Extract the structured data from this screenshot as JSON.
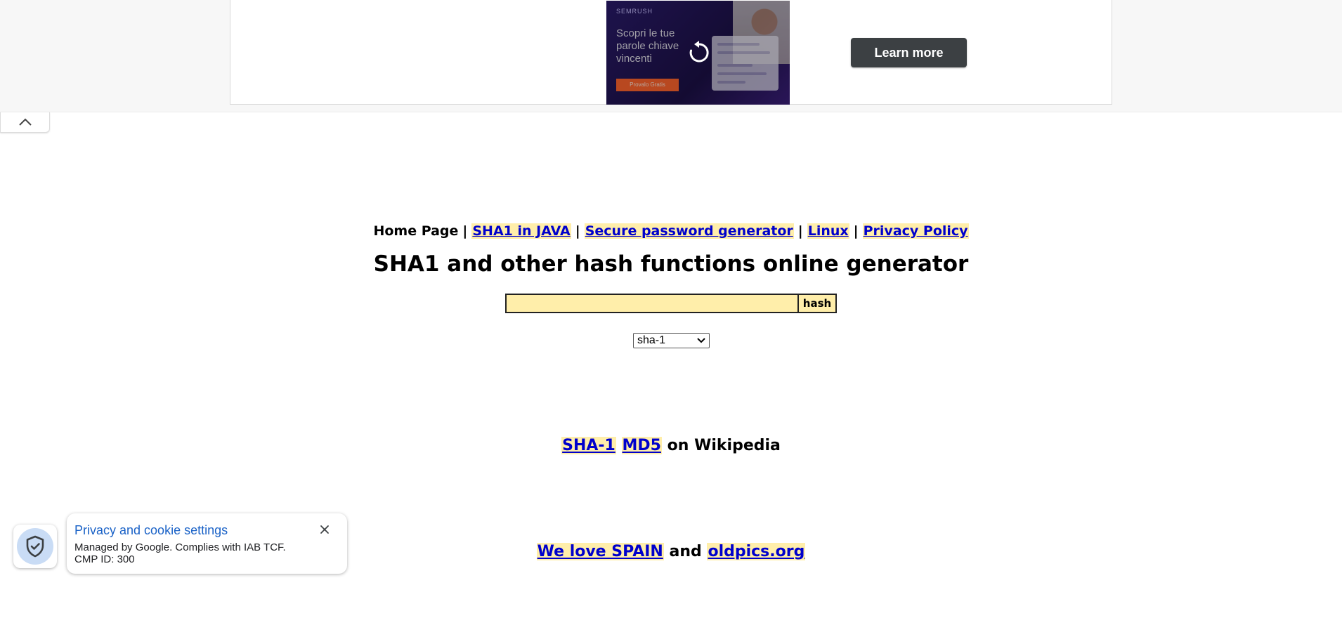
{
  "ad": {
    "brand": "SEMRUSH",
    "headline": "Scopri le tue parole chiave vincenti",
    "cta": "Provalo Gratis",
    "learn_more": "Learn more"
  },
  "nav": {
    "home": "Home Page",
    "sep": "|",
    "links": [
      {
        "label": "SHA1 in JAVA"
      },
      {
        "label": "Secure password generator"
      },
      {
        "label": "Linux"
      },
      {
        "label": "Privacy Policy"
      }
    ]
  },
  "title": "SHA1 and other hash functions online generator",
  "form": {
    "input_value": "",
    "button_label": "hash",
    "algorithm_selected": "sha-1"
  },
  "wiki": {
    "link1": "SHA-1",
    "link2": "MD5",
    "suffix": "on Wikipedia"
  },
  "footer_links": {
    "link1": "We love SPAIN",
    "middle": "and",
    "link2": "oldpics.org"
  },
  "privacy": {
    "title": "Privacy and cookie settings",
    "line1": "Managed by Google. Complies with IAB TCF.",
    "line2": "CMP ID: 300"
  },
  "colors": {
    "link": "#0000cc",
    "highlight": "#ffeeaa",
    "learn_more_bg": "#3c4043",
    "privacy_title": "#1a62c7"
  }
}
